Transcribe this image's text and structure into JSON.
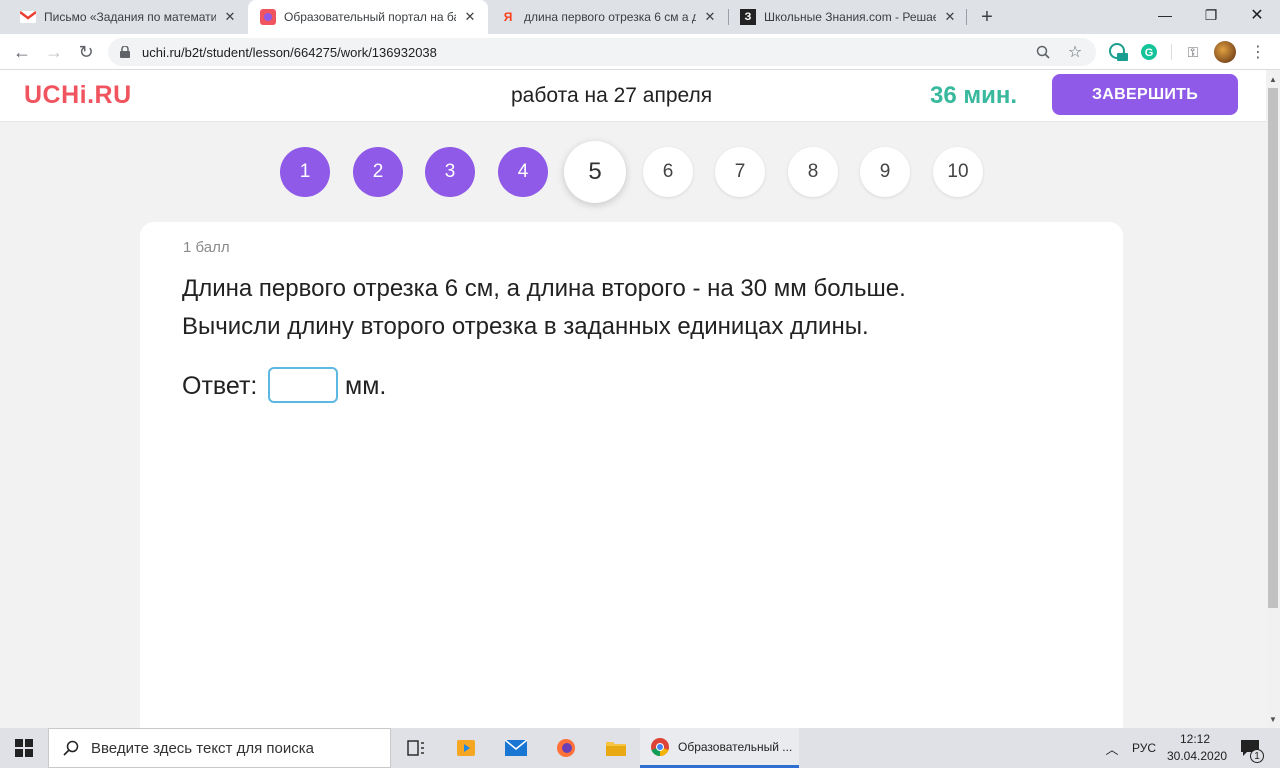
{
  "browser": {
    "tabs": [
      {
        "title": "Письмо «Задания по математи",
        "favicon": "gmail-icon",
        "active": false
      },
      {
        "title": "Образовательный портал на ба",
        "favicon": "uchi-icon",
        "active": true
      },
      {
        "title": "длина первого отрезка 6 см а д",
        "favicon": "yandex-icon",
        "active": false
      },
      {
        "title": "Школьные Знания.com - Решае",
        "favicon": "znanija-icon",
        "active": false
      }
    ],
    "url": "uchi.ru/b2t/student/lesson/664275/work/136932038"
  },
  "header": {
    "logo": "UCHi.RU",
    "title": "работа на 27 апреля",
    "timer": "36 мин.",
    "finish_label": "ЗАВЕРШИТЬ",
    "accent_color": "#8f5ae8",
    "timer_color": "#38b89d",
    "logo_color": "#f0545f"
  },
  "tasks": [
    {
      "label": "1",
      "state": "done"
    },
    {
      "label": "2",
      "state": "done"
    },
    {
      "label": "3",
      "state": "done"
    },
    {
      "label": "4",
      "state": "done"
    },
    {
      "label": "5",
      "state": "current"
    },
    {
      "label": "6",
      "state": "todo"
    },
    {
      "label": "7",
      "state": "todo"
    },
    {
      "label": "8",
      "state": "todo"
    },
    {
      "label": "9",
      "state": "todo"
    },
    {
      "label": "10",
      "state": "todo"
    }
  ],
  "card": {
    "points": "1 балл",
    "question_line1": "Длина первого отрезка 6 см, а длина второго - на 30 мм больше.",
    "question_line2": "Вычисли длину второго отрезка в заданных единицах длины.",
    "answer_label": "Ответ:",
    "answer_value": "",
    "answer_unit": "мм."
  },
  "taskbar": {
    "search_placeholder": "Введите здесь текст для поиска",
    "chrome_label": "Образовательный ...",
    "language": "РУС",
    "time": "12:12",
    "date": "30.04.2020",
    "notifications": "1"
  }
}
